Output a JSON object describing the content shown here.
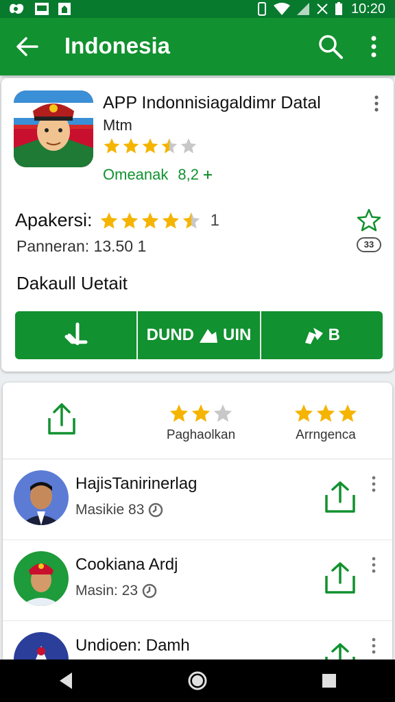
{
  "status_bar": {
    "time": "10:20",
    "icons": [
      "app-icon-1",
      "gallery-icon",
      "android-icon",
      "vibrate-icon",
      "wifi-icon",
      "signal-icon",
      "no-sim-icon",
      "battery-icon"
    ]
  },
  "app_bar": {
    "title": "Indonesia",
    "back_icon": "arrow-left-icon",
    "search_icon": "search-icon",
    "more_icon": "more-vert-icon",
    "color": "#11912f"
  },
  "app_card": {
    "name": "APP Indonnisiagaldimr Datal",
    "subtitle": "Mtm",
    "stars": 3.5,
    "developer": "Omeanak",
    "developer_count": "8,2",
    "rating_label": "Apakersi:",
    "rating_stars": 4.5,
    "rating_count": "1",
    "downloads": "Panneran: 13.50 1",
    "size_badge": "33",
    "details_title": "Dakaull Uetait",
    "buttons": [
      {
        "label": "",
        "icon": "download-icon"
      },
      {
        "label": "DUND",
        "label2": "UIN",
        "icon": "upload-icon"
      },
      {
        "label": "B",
        "icon": "share-box-icon"
      }
    ]
  },
  "summary": {
    "share_icon": "share-icon",
    "col1": {
      "label": "Paghaolkan",
      "stars": 2
    },
    "col2": {
      "label": "Arrngenca",
      "stars": 3
    }
  },
  "list": [
    {
      "name": "HajisTanirinerlag",
      "meta": "Masikie 83",
      "avatar": "person-blue"
    },
    {
      "name": "Cookiana Ardj",
      "meta": "Masin: 23",
      "avatar": "person-green"
    },
    {
      "name": "Undioen: Damh",
      "meta": "",
      "avatar": "person-navy"
    }
  ],
  "colors": {
    "primary": "#11912f",
    "primary_dark": "#087a2e",
    "star": "#f5b400",
    "star_empty": "#c8c8c8"
  }
}
